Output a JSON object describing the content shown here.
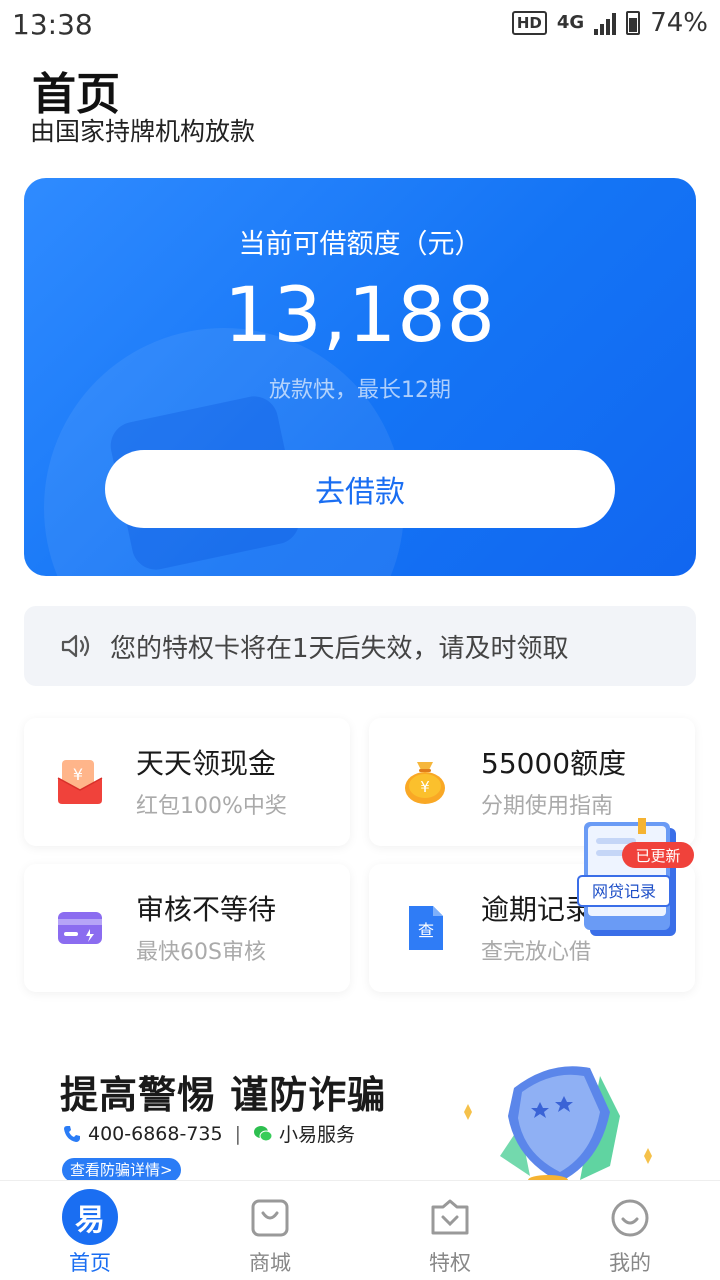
{
  "status_bar": {
    "time": "13:38",
    "hd": "HD",
    "network": "4G",
    "battery": "74%"
  },
  "header": {
    "title": "首页",
    "subtitle": "由国家持牌机构放款"
  },
  "credit": {
    "label": "当前可借额度（元）",
    "amount": "13,188",
    "note": "放款快，最长12期",
    "button_label": "去借款"
  },
  "notice": {
    "icon": "speaker-icon",
    "text": "您的特权卡将在1天后失效，请及时领取"
  },
  "tiles": [
    {
      "title": "天天领现金",
      "subtitle": "红包100%中奖",
      "icon": "red-envelope-icon"
    },
    {
      "title": "55000额度",
      "subtitle": "分期使用指南",
      "icon": "money-bag-icon"
    },
    {
      "title": "审核不等待",
      "subtitle": "最快60S审核",
      "icon": "card-icon"
    },
    {
      "title": "逾期记录",
      "subtitle": "查完放心借",
      "icon": "document-icon"
    }
  ],
  "record_badge": {
    "tag": "已更新",
    "label": "网贷记录"
  },
  "fraud_banner": {
    "title": "提高警惕 谨防诈骗",
    "phone": "400-6868-735",
    "separator": "|",
    "wechat": "小易服务",
    "detail_button": "查看防骗详情>"
  },
  "colors": {
    "primary": "#1a6ef2",
    "card_gradient_start": "#2f8bff",
    "notice_bg": "#f2f4f8"
  },
  "nav": {
    "home_logo": "易",
    "items": [
      {
        "label": "首页",
        "icon": "home-icon",
        "active": true
      },
      {
        "label": "商城",
        "icon": "shopping-bag-icon",
        "active": false
      },
      {
        "label": "特权",
        "icon": "privilege-icon",
        "active": false
      },
      {
        "label": "我的",
        "icon": "profile-icon",
        "active": false
      }
    ]
  }
}
